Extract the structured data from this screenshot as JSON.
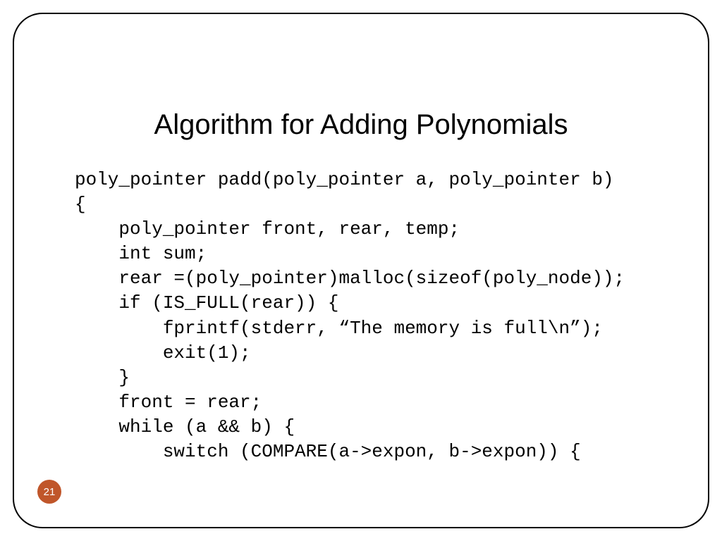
{
  "slide": {
    "title": "Algorithm for Adding Polynomials",
    "page_number": "21",
    "code": "poly_pointer padd(poly_pointer a, poly_pointer b)\n{\n    poly_pointer front, rear, temp;\n    int sum;\n    rear =(poly_pointer)malloc(sizeof(poly_node));\n    if (IS_FULL(rear)) {\n        fprintf(stderr, “The memory is full\\n”);\n        exit(1);\n    }\n    front = rear;\n    while (a && b) {\n        switch (COMPARE(a->expon, b->expon)) {"
  }
}
